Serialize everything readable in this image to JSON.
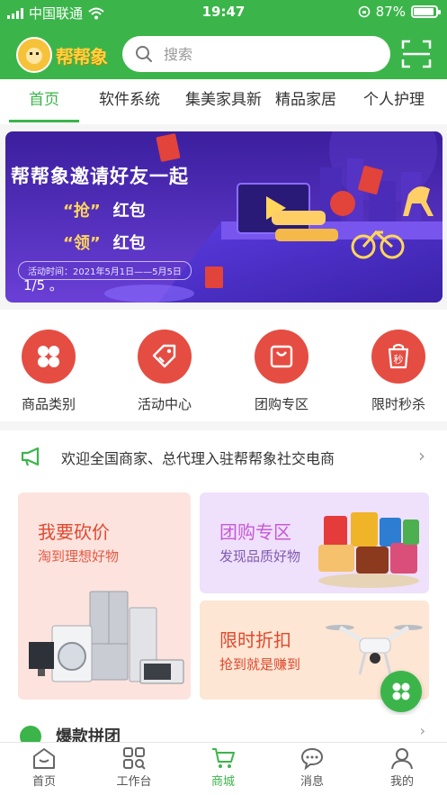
{
  "status_bar": {
    "carrier": "中国联通",
    "time": "19:47",
    "battery": "87%"
  },
  "header": {
    "logo_text": "帮帮象",
    "search_placeholder": "搜索"
  },
  "tabs": [
    {
      "label": "首页",
      "active": true
    },
    {
      "label": "软件系统",
      "active": false
    },
    {
      "label": "集美家具新",
      "active": false
    },
    {
      "label": "精品家居",
      "active": false
    },
    {
      "label": "个人护理",
      "active": false
    }
  ],
  "banner": {
    "title": "帮帮象邀请好友一起",
    "line1_quote": "“抢”",
    "line1_text": "红包",
    "line2_quote": "“领”",
    "line2_text": "红包",
    "date": "活动时间：2021年5月1日——5月5日",
    "pager": "1/5 。"
  },
  "categories": [
    {
      "label": "商品类别",
      "icon": "grid-icon"
    },
    {
      "label": "活动中心",
      "icon": "tag-icon"
    },
    {
      "label": "团购专区",
      "icon": "bag-icon"
    },
    {
      "label": "限时秒杀",
      "icon": "flash-sale-icon",
      "icon_text": "秒"
    }
  ],
  "notice": {
    "text": "欢迎全国商家、总代理入驻帮帮象社交电商"
  },
  "promos": [
    {
      "title": "我要砍价",
      "subtitle": "淘到理想好物",
      "title_color": "#e0482f",
      "subtitle_color": "#e35a44",
      "bg": "#fde3de"
    },
    {
      "title": "团购专区",
      "subtitle": "发现品质好物",
      "title_color": "#c75ad6",
      "subtitle_color": "#7f5bb0",
      "bg": "#efe0fb"
    },
    {
      "title": "限时折扣",
      "subtitle": "抢到就是赚到",
      "title_color": "#e0482f",
      "subtitle_color": "#e0482f",
      "bg": "#fde6d4"
    }
  ],
  "section_peek": {
    "text": "爆款拼团"
  },
  "tabbar": [
    {
      "label": "首页",
      "icon": "home-icon",
      "active": false
    },
    {
      "label": "工作台",
      "icon": "workbench-icon",
      "active": false
    },
    {
      "label": "商城",
      "icon": "cart-icon",
      "active": true
    },
    {
      "label": "消息",
      "icon": "message-icon",
      "active": false
    },
    {
      "label": "我的",
      "icon": "user-icon",
      "active": false
    }
  ],
  "colors": {
    "brand_green": "#3bb54a",
    "category_red": "#e54d42",
    "banner_purple": "#4a2fb0"
  }
}
